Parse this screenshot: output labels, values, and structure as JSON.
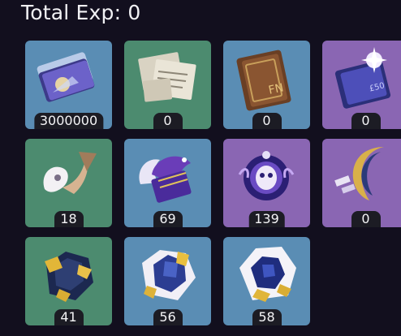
{
  "header": {
    "total_exp": "Total Exp: 0"
  },
  "items": [
    {
      "icon": "hero-wit-cards-icon",
      "count": "3000000",
      "rarity": "r3"
    },
    {
      "icon": "papers-icon",
      "count": "0",
      "rarity": "r2"
    },
    {
      "icon": "brown-book-icon",
      "count": "0",
      "rarity": "r3"
    },
    {
      "icon": "purple-book-sparkle-icon",
      "count": "0",
      "rarity": "r4"
    },
    {
      "icon": "white-feather-mask-icon",
      "count": "18",
      "rarity": "r2"
    },
    {
      "icon": "purple-bird-spirit-icon",
      "count": "69",
      "rarity": "r3"
    },
    {
      "icon": "purple-mask-skull-icon",
      "count": "139",
      "rarity": "r4"
    },
    {
      "icon": "crescent-moon-icon",
      "count": "0",
      "rarity": "r4"
    },
    {
      "icon": "dark-ore-gold-icon",
      "count": "41",
      "rarity": "r2"
    },
    {
      "icon": "blue-ore-gold-icon",
      "count": "56",
      "rarity": "r3"
    },
    {
      "icon": "white-crystal-ore-icon",
      "count": "58",
      "rarity": "r3"
    }
  ],
  "colors": {
    "background": "#120f1e",
    "tile_green": "#4c8b6f",
    "tile_blue": "#5a8db4",
    "tile_purple": "#8a66b3",
    "count_bg": "#1c1c24"
  }
}
